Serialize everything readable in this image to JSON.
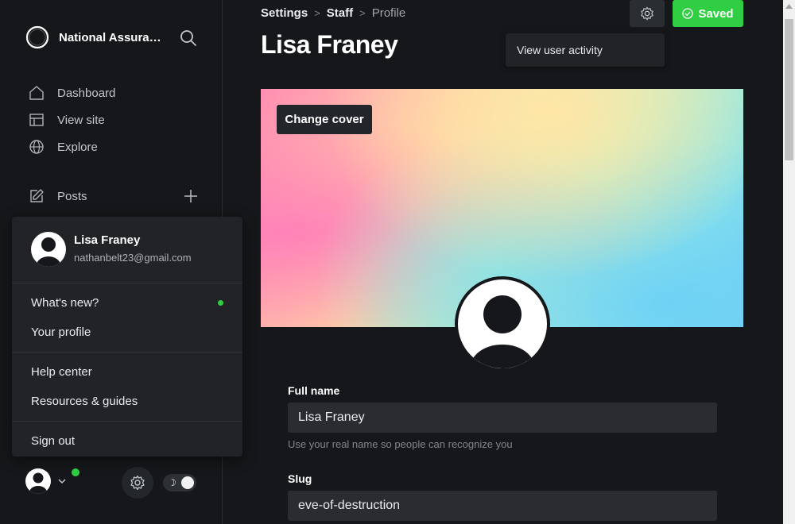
{
  "sidebar": {
    "brand_name": "National Assura…",
    "nav": [
      {
        "label": "Dashboard",
        "icon": "home-icon"
      },
      {
        "label": "View site",
        "icon": "layout-icon"
      },
      {
        "label": "Explore",
        "icon": "globe-icon"
      }
    ],
    "posts_label": "Posts"
  },
  "user_menu": {
    "name": "Lisa Franey",
    "email": "nathanbelt23@gmail.com",
    "items": {
      "whats_new": "What's new?",
      "your_profile": "Your profile",
      "help_center": "Help center",
      "resources": "Resources & guides",
      "sign_out": "Sign out"
    }
  },
  "header": {
    "breadcrumb": [
      "Settings",
      "Staff",
      "Profile"
    ],
    "title": "Lisa Franey",
    "saved_label": "Saved",
    "actions_menu_item": "View user activity"
  },
  "cover": {
    "change_cover_label": "Change cover"
  },
  "form": {
    "full_name_label": "Full name",
    "full_name_value": "Lisa Franey",
    "full_name_hint": "Use your real name so people can recognize you",
    "slug_label": "Slug",
    "slug_value": "eve-of-destruction"
  },
  "colors": {
    "accent_green": "#30cf43",
    "background": "#15171a",
    "panel": "#212327"
  }
}
